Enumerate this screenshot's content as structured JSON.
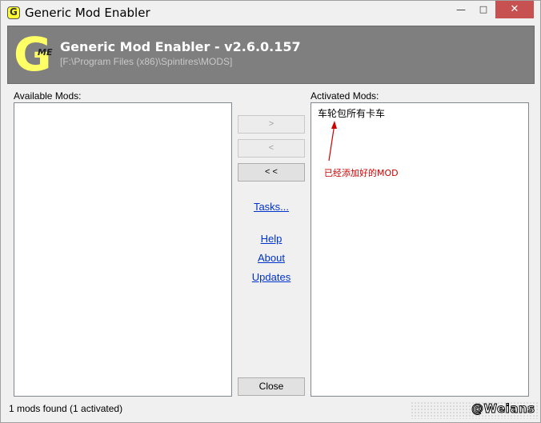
{
  "window": {
    "title": "Generic Mod Enabler",
    "minimize_glyph": "—",
    "maximize_glyph": "□",
    "close_glyph": "✕"
  },
  "banner": {
    "logo_letter": "G",
    "logo_sub": "ME",
    "app_name": "Generic Mod Enabler - v2.6.0.157",
    "path": "[F:\\Program Files (x86)\\Spintires\\MODS]"
  },
  "available": {
    "label": "Available Mods:",
    "items": []
  },
  "activated": {
    "label": "Activated Mods:",
    "items": [
      "车轮包所有卡车"
    ]
  },
  "buttons": {
    "add": ">",
    "remove": "<",
    "remove_all": "< <",
    "close": "Close"
  },
  "links": {
    "tasks": "Tasks...",
    "help": "Help",
    "about": "About",
    "updates": "Updates"
  },
  "annotation": {
    "text": "已经添加好的MOD",
    "color": "#cc0000"
  },
  "status": {
    "text": "1 mods found (1 activated)",
    "watermark": "@Weians"
  },
  "colors": {
    "banner_bg": "#7f7f7f",
    "logo": "#ffff66",
    "link": "#0033cc",
    "close_button": "#c75050"
  }
}
